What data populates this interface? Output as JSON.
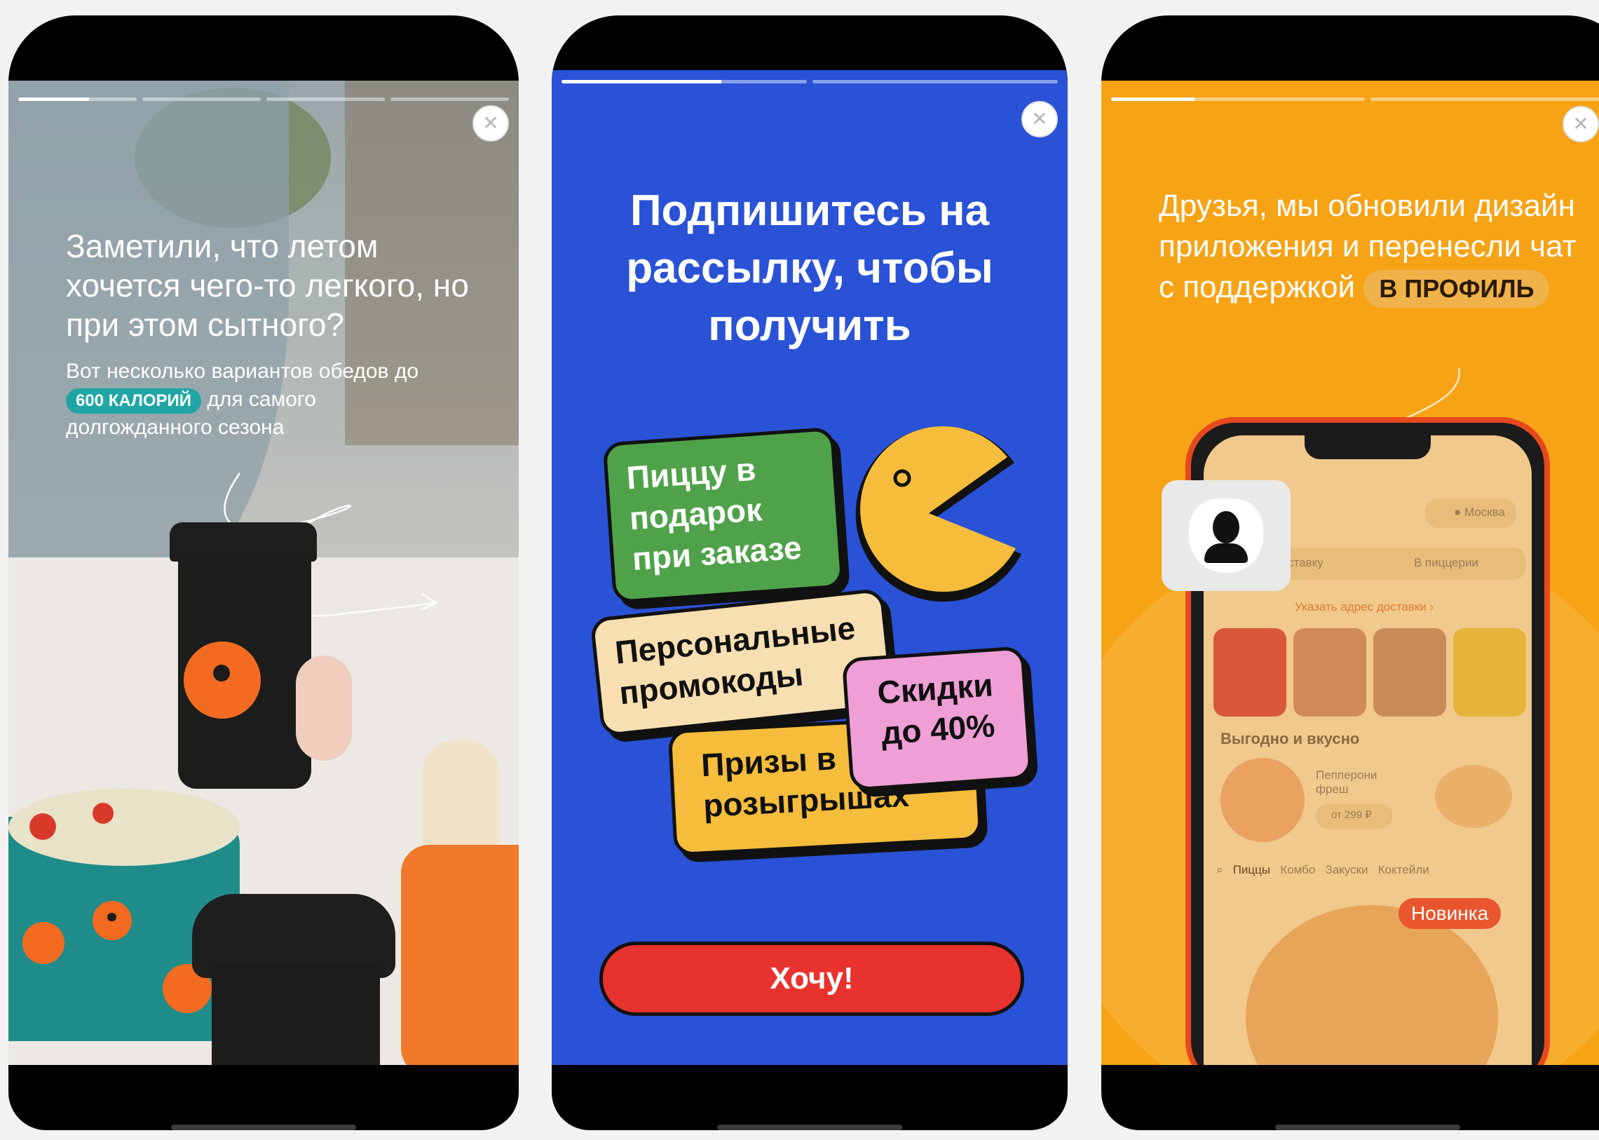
{
  "colors": {
    "story1_accent": "#1fa6a4",
    "story2_background": "#2a52d6",
    "story2_button": "#e8322d",
    "story3_background": "#f6a316",
    "brand_orange": "#f26b21"
  },
  "stories": [
    {
      "progress_segments": [
        0.6,
        0,
        0,
        0
      ],
      "title": "Заметили, что летом хочется чего-то легкого, но при этом сытного?",
      "subtitle_before": "Вот несколько вариантов обедов до",
      "calories_badge": "600 КАЛОРИЙ",
      "subtitle_after": "для самого долгожданного сезона",
      "close_icon": "close-icon"
    },
    {
      "progress_segments": [
        0.65,
        0
      ],
      "title": "Подпишитесь на рассылку, чтобы получить",
      "stickers": {
        "pizza_gift": "Пиццу в подарок при заказе",
        "promo_codes": "Персональные промокоды",
        "discounts": "Скидки до 40%",
        "prizes": "Призы в розыгрышах"
      },
      "cta_label": "Хочу!",
      "close_icon": "close-icon"
    },
    {
      "progress_segments": [
        0.33,
        0
      ],
      "title": "Друзья, мы обновили дизайн приложения и перенесли чат с поддержкой",
      "title_badge": "В ПРОФИЛЬ",
      "mockup": {
        "city": "Москва",
        "tab_delivery": "ставку",
        "tab_pizzeria": "В пиццерии",
        "address_link": "Указать адрес доставки",
        "section_title": "Выгодно и вкусно",
        "product_name": "Пепперони фреш",
        "product_price": "от 299 ₽",
        "categories": [
          "Пиццы",
          "Комбо",
          "Закуски",
          "Коктейли"
        ],
        "new_badge": "Новинка"
      },
      "close_icon": "close-icon"
    }
  ]
}
